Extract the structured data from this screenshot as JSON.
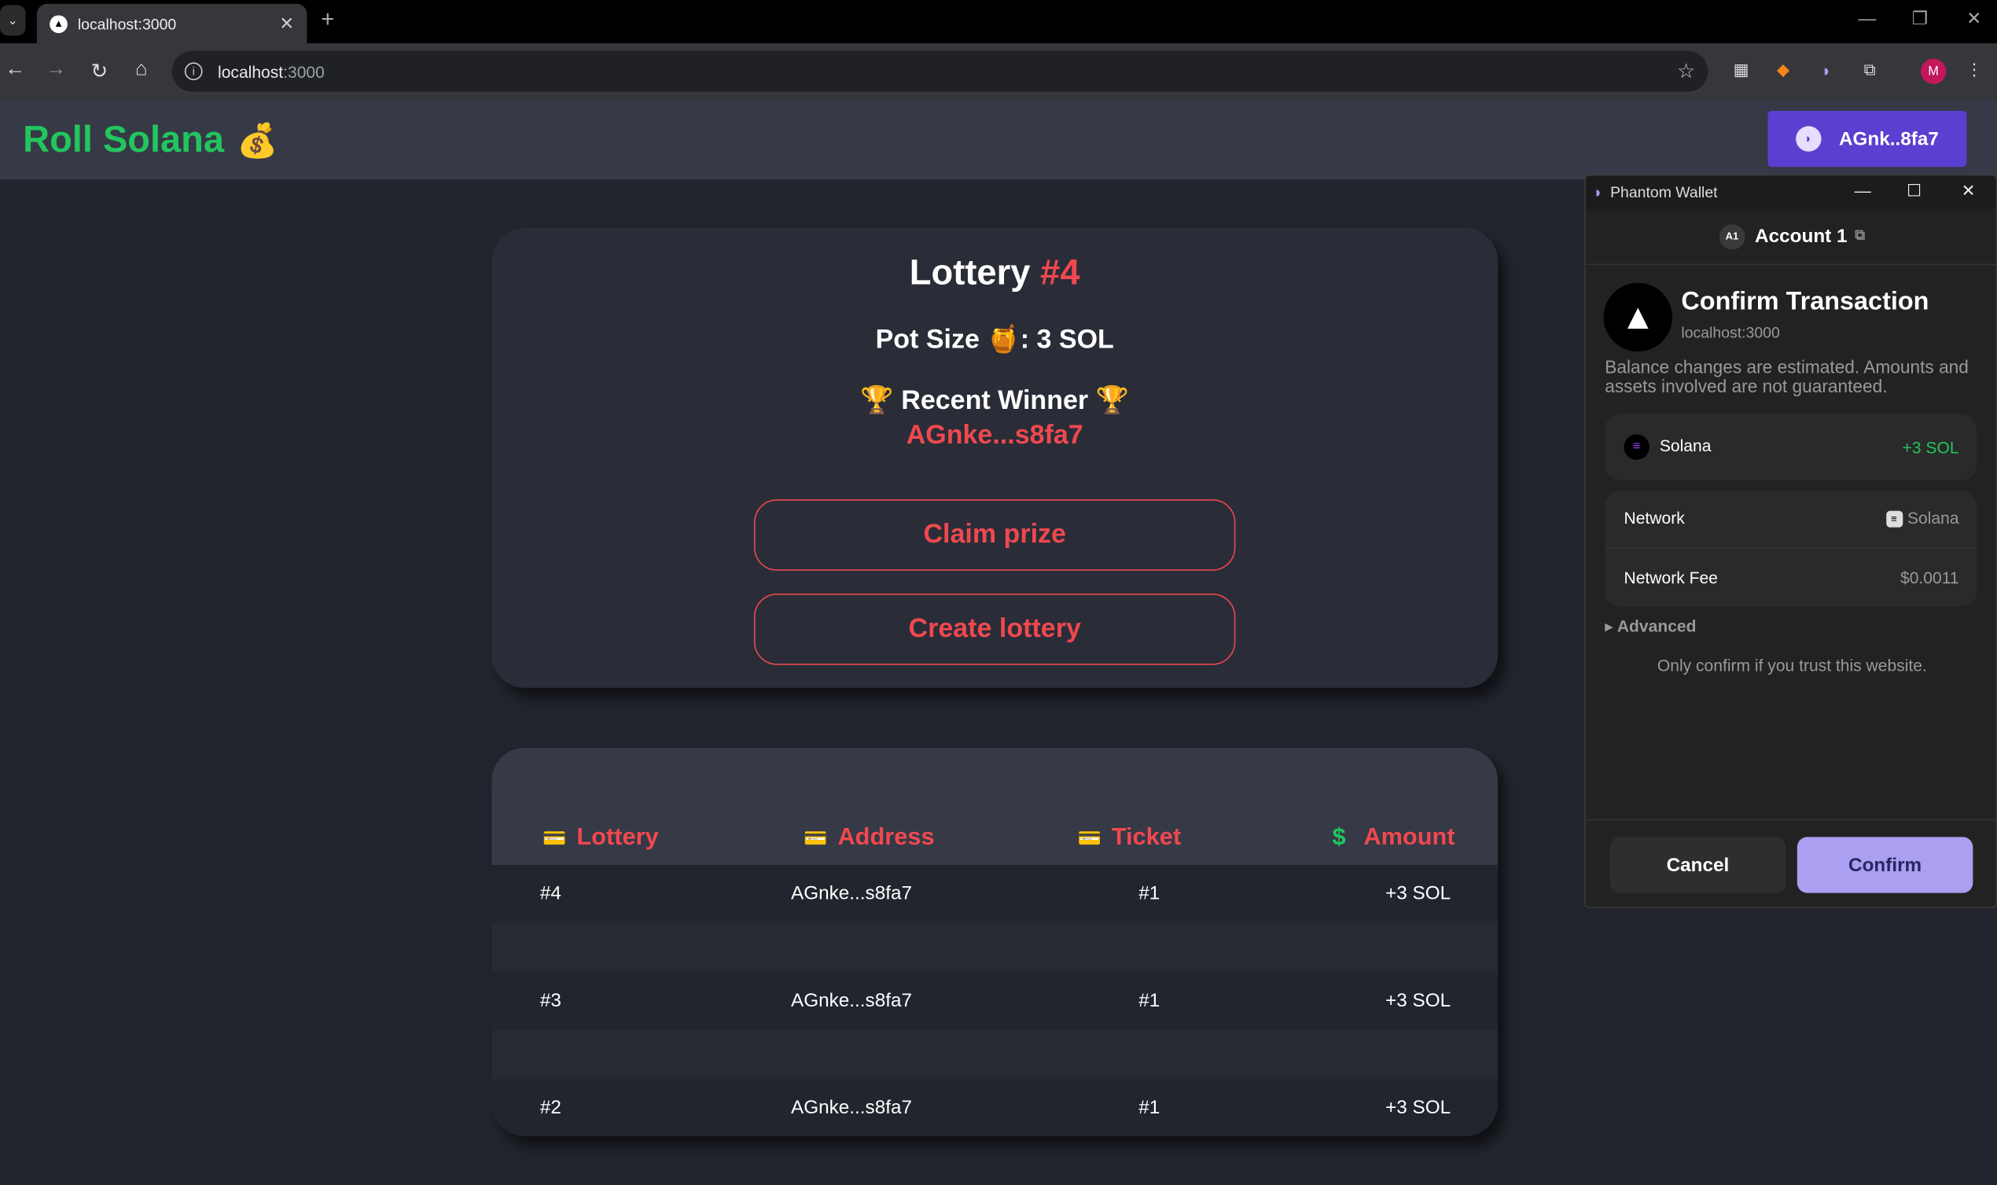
{
  "browser": {
    "tab_title": "localhost:3000",
    "url_host": "localhost",
    "url_port": ":3000",
    "profile_initial": "M"
  },
  "app": {
    "brand": "Roll Solana",
    "wallet_button": "AGnk..8fa7",
    "lottery_label": "Lottery",
    "lottery_number": "#4",
    "pot_label": "Pot Size",
    "pot_value": ": 3 SOL",
    "recent_winner_label": "Recent Winner",
    "recent_winner_address": "AGnke...s8fa7",
    "claim_prize": "Claim prize",
    "create_lottery": "Create lottery"
  },
  "table": {
    "columns": [
      "Lottery",
      "Address",
      "Ticket",
      "Amount"
    ],
    "rows": [
      {
        "lottery": "#4",
        "address": "AGnke...s8fa7",
        "ticket": "#1",
        "amount": "+3 SOL"
      },
      {
        "lottery": "#3",
        "address": "AGnke...s8fa7",
        "ticket": "#1",
        "amount": "+3 SOL"
      },
      {
        "lottery": "#2",
        "address": "AGnke...s8fa7",
        "ticket": "#1",
        "amount": "+3 SOL"
      }
    ]
  },
  "phantom": {
    "window_title": "Phantom Wallet",
    "account_badge": "A1",
    "account": "Account 1",
    "title": "Confirm Transaction",
    "site": "localhost:3000",
    "note": "Balance changes are estimated. Amounts and assets involved are not guaranteed.",
    "asset_name": "Solana",
    "asset_change": "+3 SOL",
    "network_label": "Network",
    "network_value": "Solana",
    "fee_label": "Network Fee",
    "fee_value": "$0.0011",
    "advanced": "Advanced",
    "trust_note": "Only confirm if you trust this website.",
    "cancel": "Cancel",
    "confirm": "Confirm"
  },
  "colors": {
    "accent_red": "#f0484f",
    "brand_green": "#22c55e",
    "wallet_purple": "#5b3fd0",
    "phantom_confirm": "#ab9ff2"
  }
}
